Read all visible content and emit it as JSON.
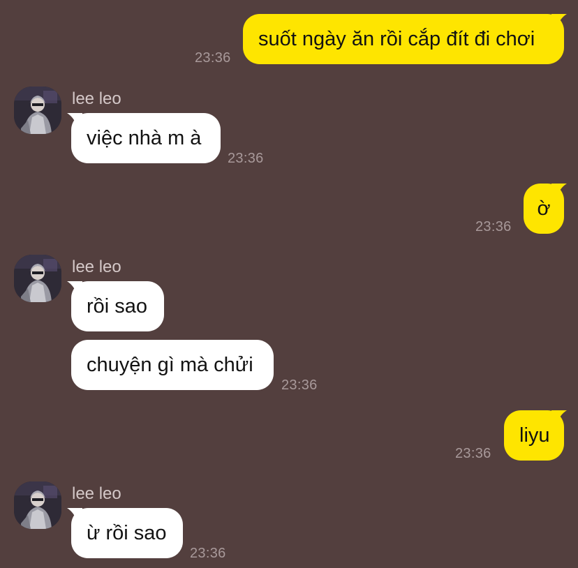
{
  "colors": {
    "background": "#533f3e",
    "outgoing_bubble": "#fee500",
    "incoming_bubble": "#ffffff",
    "timestamp": "#a8999a",
    "sender_name": "#d4c8c8"
  },
  "messages": [
    {
      "direction": "outgoing",
      "text": "suốt ngày ăn rồi cắp đít đi chơi",
      "time": "23:36"
    },
    {
      "direction": "incoming",
      "sender": "lee leo",
      "avatar_icon": "user-avatar-icon",
      "text": "việc nhà m à",
      "time": "23:36"
    },
    {
      "direction": "outgoing",
      "text": "ờ",
      "time": "23:36"
    },
    {
      "direction": "incoming",
      "sender": "lee leo",
      "avatar_icon": "user-avatar-icon",
      "texts": [
        "rồi sao",
        "chuyện gì mà chửi"
      ],
      "time": "23:36"
    },
    {
      "direction": "outgoing",
      "text": "liyu",
      "time": "23:36"
    },
    {
      "direction": "incoming",
      "sender": "lee leo",
      "avatar_icon": "user-avatar-icon",
      "text": "ừ rồi sao",
      "time": "23:36"
    }
  ]
}
